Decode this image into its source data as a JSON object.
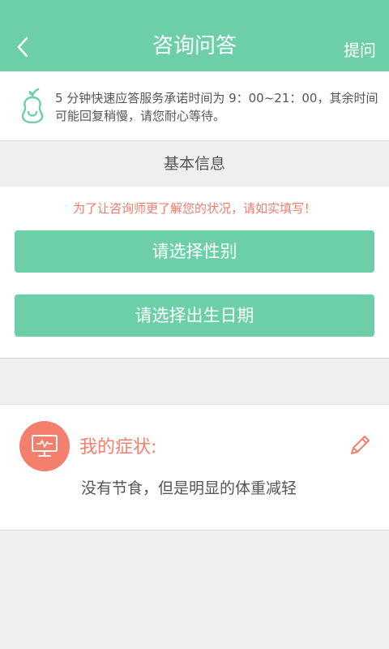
{
  "header": {
    "title": "咨询问答",
    "ask_label": "提问",
    "background": "#6ccfa8"
  },
  "notice": {
    "icon": "pear-logo-icon",
    "text": "5 分钟快速应答服务承诺时间为 9：00~21：00，其余时间可能回复稍慢，请您耐心等待。"
  },
  "basic_info": {
    "title": "基本信息",
    "hint": "为了让咨询师更了解您的状况，请如实填写！",
    "gender_button": "请选择性别",
    "birth_button": "请选择出生日期"
  },
  "symptoms": {
    "icon": "monitor-icon",
    "label": "我的症状:",
    "text": "没有节食，但是明显的体重减轻",
    "accent": "#f47f6c"
  }
}
